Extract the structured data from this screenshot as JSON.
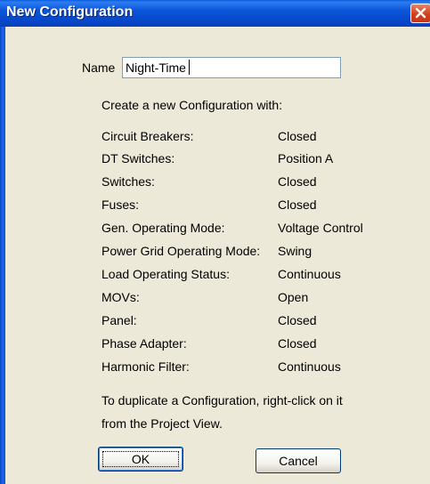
{
  "dialog": {
    "title": "New Configuration",
    "close_icon": "close-icon",
    "name_label": "Name",
    "name_value": "Night-Time",
    "intro": "Create a new Configuration with:",
    "settings": [
      {
        "label": "Circuit Breakers:",
        "value": "Closed"
      },
      {
        "label": "DT Switches:",
        "value": "Position A"
      },
      {
        "label": "Switches:",
        "value": "Closed"
      },
      {
        "label": "Fuses:",
        "value": "Closed"
      },
      {
        "label": "Gen. Operating Mode:",
        "value": "Voltage Control"
      },
      {
        "label": "Power Grid Operating Mode:",
        "value": "Swing"
      },
      {
        "label": "Load Operating Status:",
        "value": "Continuous"
      },
      {
        "label": "MOVs:",
        "value": "Open"
      },
      {
        "label": "Panel:",
        "value": "Closed"
      },
      {
        "label": "Phase Adapter:",
        "value": "Closed"
      },
      {
        "label": "Harmonic Filter:",
        "value": "Continuous"
      }
    ],
    "hint_line1": "To duplicate a Configuration, right-click on it",
    "hint_line2": "from the Project View.",
    "ok_label": "OK",
    "cancel_label": "Cancel"
  },
  "colors": {
    "titlebar": "#0747C8",
    "dialog_bg": "#ECE9D8",
    "close_button": "#D1401E"
  }
}
